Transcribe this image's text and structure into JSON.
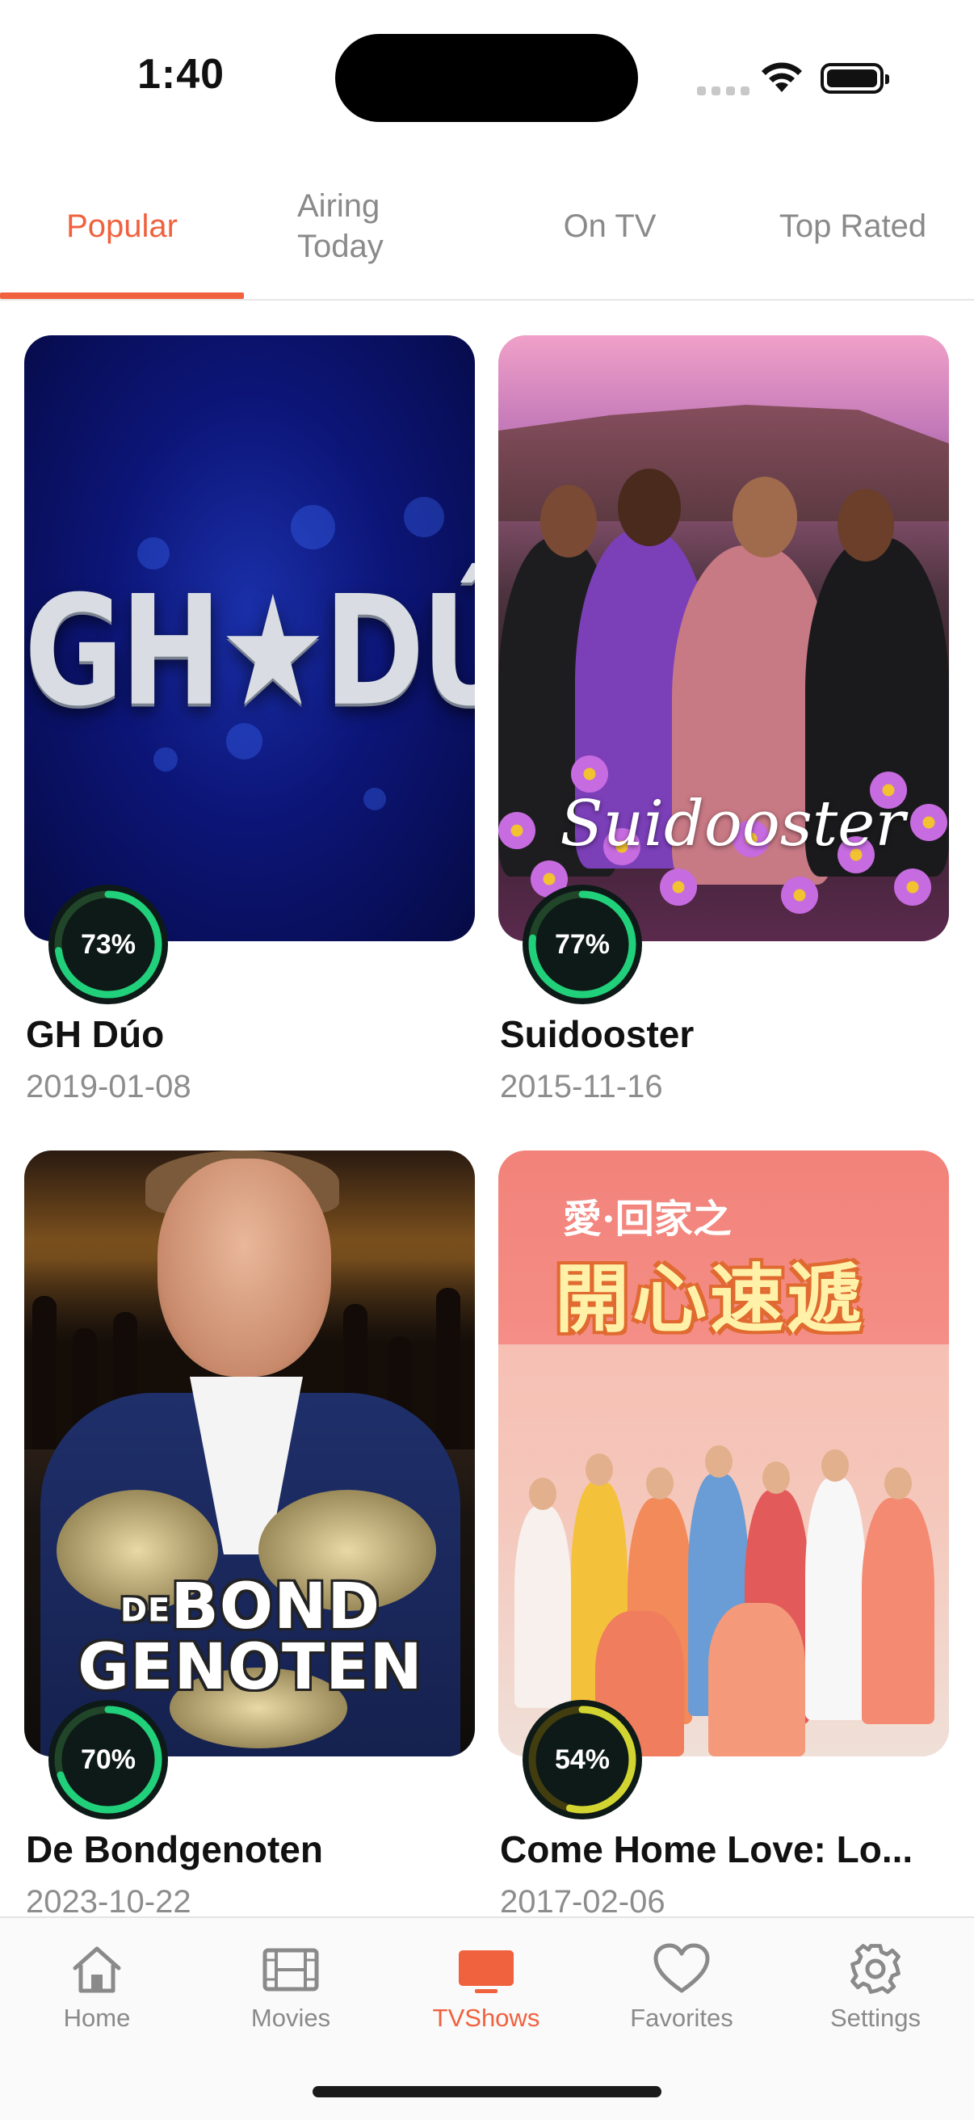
{
  "status_bar": {
    "time": "1:40"
  },
  "tabs": [
    {
      "label": "Popular",
      "active": true
    },
    {
      "label": "Airing\nToday",
      "active": false
    },
    {
      "label": "On TV",
      "active": false
    },
    {
      "label": "Top Rated",
      "active": false
    }
  ],
  "shows": [
    {
      "title": "GH Dúo",
      "date": "2019-01-08",
      "score": 73,
      "score_label": "73%",
      "poster_text": "GH★DÚO"
    },
    {
      "title": "Suidooster",
      "date": "2015-11-16",
      "score": 77,
      "score_label": "77%",
      "poster_text": "Suidooster"
    },
    {
      "title": "De Bondgenoten",
      "date": "2023-10-22",
      "score": 70,
      "score_label": "70%",
      "poster_text_1": "DE",
      "poster_text_2": "BOND",
      "poster_text_3": "GENOTEN"
    },
    {
      "title": "Come Home Love: Lo...",
      "date": "2017-02-06",
      "score": 54,
      "score_label": "54%",
      "poster_text_1": "愛·回家之",
      "poster_text_2": "開心速遞"
    }
  ],
  "score_colors": {
    "high": "#21d07a",
    "mid": "#d2d531",
    "track_high": "#204529",
    "track_mid": "#423d0f"
  },
  "tabbar": {
    "items": [
      {
        "label": "Home",
        "icon": "house-icon"
      },
      {
        "label": "Movies",
        "icon": "film-icon"
      },
      {
        "label": "TVShows",
        "icon": "tv-icon",
        "active": true
      },
      {
        "label": "Favorites",
        "icon": "heart-icon"
      },
      {
        "label": "Settings",
        "icon": "gear-icon"
      }
    ]
  },
  "accent": "#f0613e"
}
